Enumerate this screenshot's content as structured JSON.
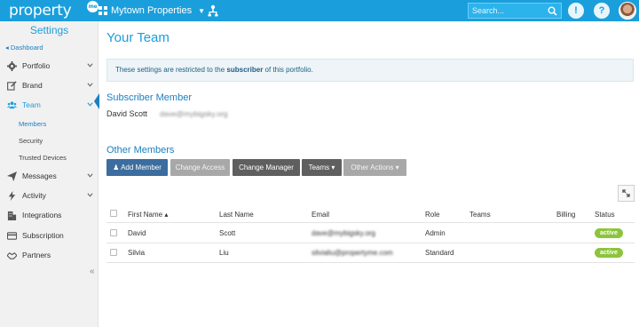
{
  "topbar": {
    "logo_text": "property",
    "logo_badge": "me",
    "portfolio": "Mytown Properties",
    "search_placeholder": "Search...",
    "help_glyph": "?",
    "alert_glyph": "!",
    "brand_color": "#1a9fdc"
  },
  "sidebar": {
    "title": "Settings",
    "back_link": "Dashboard",
    "items": [
      {
        "label": "Portfolio",
        "icon": "gear-icon"
      },
      {
        "label": "Brand",
        "icon": "edit-icon"
      },
      {
        "label": "Team",
        "icon": "users-icon"
      },
      {
        "label": "Messages",
        "icon": "paper-plane-icon"
      },
      {
        "label": "Activity",
        "icon": "bolt-icon"
      },
      {
        "label": "Integrations",
        "icon": "building-icon"
      },
      {
        "label": "Subscription",
        "icon": "credit-card-icon"
      },
      {
        "label": "Partners",
        "icon": "handshake-icon"
      }
    ],
    "team_subitems": [
      "Members",
      "Security",
      "Trusted Devices"
    ],
    "collapse_glyph": "«"
  },
  "main": {
    "title": "Your Team",
    "notice_pre": "These settings are restricted to the ",
    "notice_link": "subscriber",
    "notice_post": " of this portfolio.",
    "subscriber_heading": "Subscriber Member",
    "subscriber_name": "David Scott",
    "subscriber_email": "dave@mybigsky.org",
    "other_heading": "Other Members",
    "buttons": {
      "add_member": "Add Member",
      "change_access": "Change Access",
      "change_manager": "Change Manager",
      "teams": "Teams",
      "other_actions": "Other Actions"
    },
    "table": {
      "headers": [
        "First Name",
        "Last Name",
        "Email",
        "Role",
        "Teams",
        "Billing",
        "Status"
      ],
      "rows": [
        {
          "first": "David",
          "last": "Scott",
          "email": "dave@mybigsky.org",
          "role": "Admin",
          "teams": "",
          "billing": "",
          "status": "active"
        },
        {
          "first": "Silvia",
          "last": "Liu",
          "email": "silvialiu@propertyme.com",
          "role": "Standard",
          "teams": "",
          "billing": "",
          "status": "active"
        }
      ]
    }
  }
}
